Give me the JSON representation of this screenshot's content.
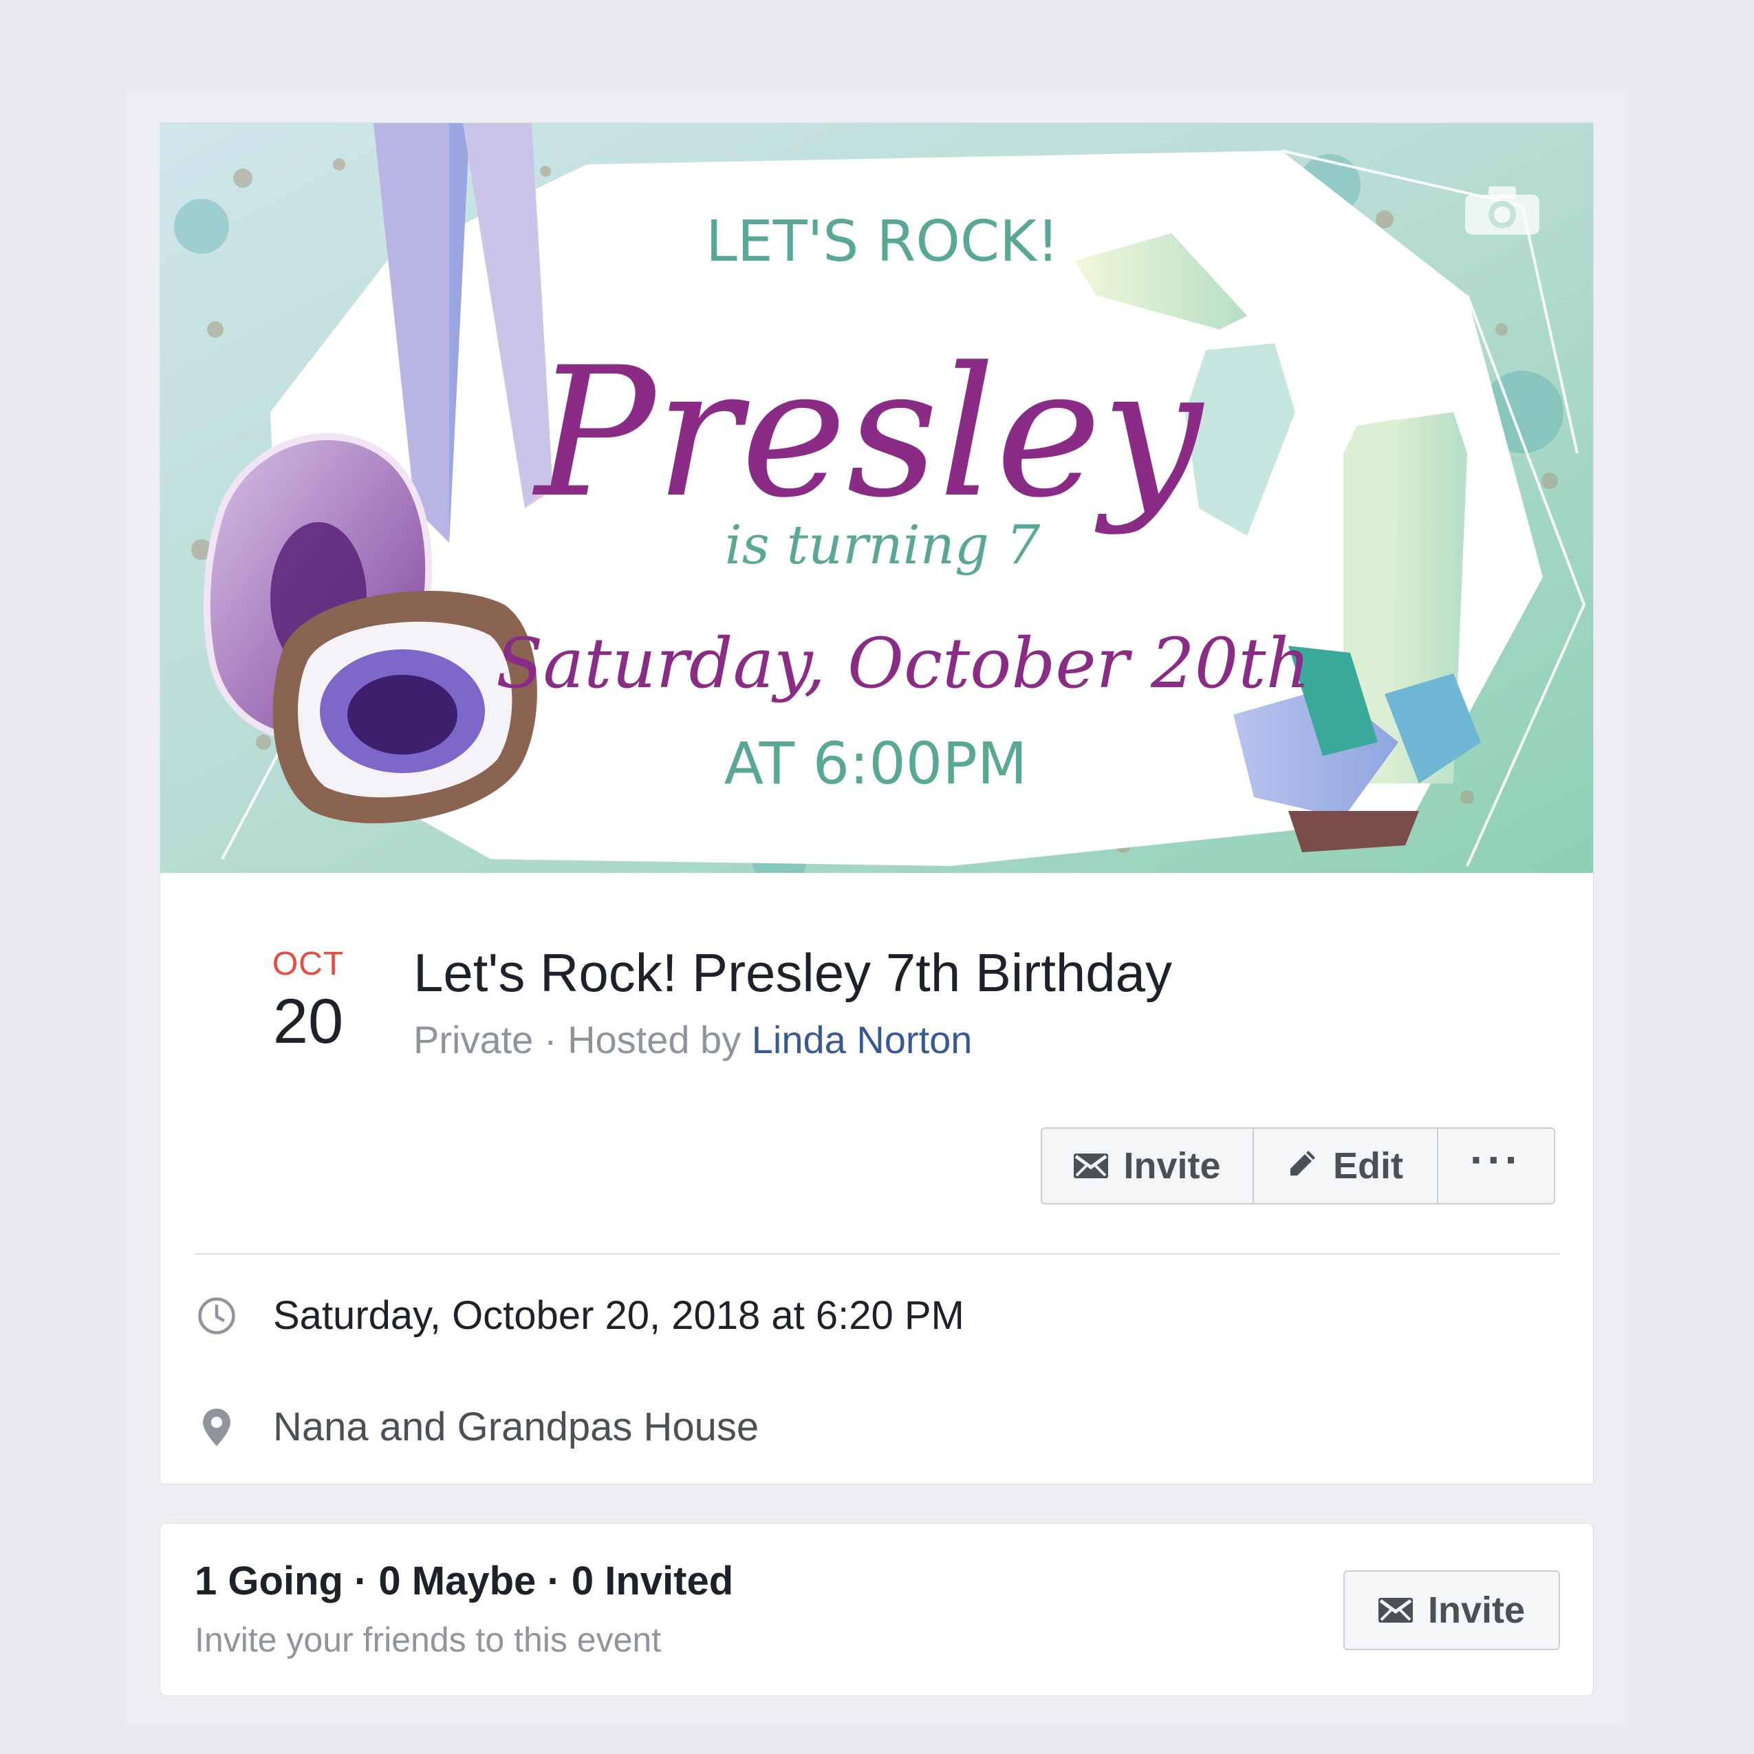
{
  "cover": {
    "headline": "LET'S ROCK!",
    "name": "Presley",
    "subline": "is turning 7",
    "date_line": "Saturday, October 20th",
    "time_line": "AT 6:00PM",
    "camera_icon": "camera-icon",
    "colors": {
      "purple": "#8a2c86",
      "teal": "#58a895"
    }
  },
  "event": {
    "month": "OCT",
    "day": "20",
    "title": "Let's Rock! Presley 7th Birthday",
    "privacy": "Private",
    "separator": " · ",
    "hosted_by_label": "Hosted by ",
    "host": "Linda Norton"
  },
  "actions": {
    "invite_label": "Invite",
    "edit_label": "Edit",
    "more_label": "···",
    "invite_icon": "envelope-icon",
    "edit_icon": "pencil-icon"
  },
  "details": {
    "datetime": "Saturday, October 20, 2018 at 6:20 PM",
    "location": "Nana and Grandpas House",
    "datetime_icon": "clock-icon",
    "location_icon": "map-pin-icon"
  },
  "guests": {
    "counts": "1 Going · 0 Maybe · 0 Invited",
    "subtitle": "Invite your friends to this event",
    "invite_label": "Invite"
  },
  "theme": {
    "accent_red": "#e74c3c",
    "link_blue": "#385898",
    "page_bg": "#e9ebee"
  }
}
